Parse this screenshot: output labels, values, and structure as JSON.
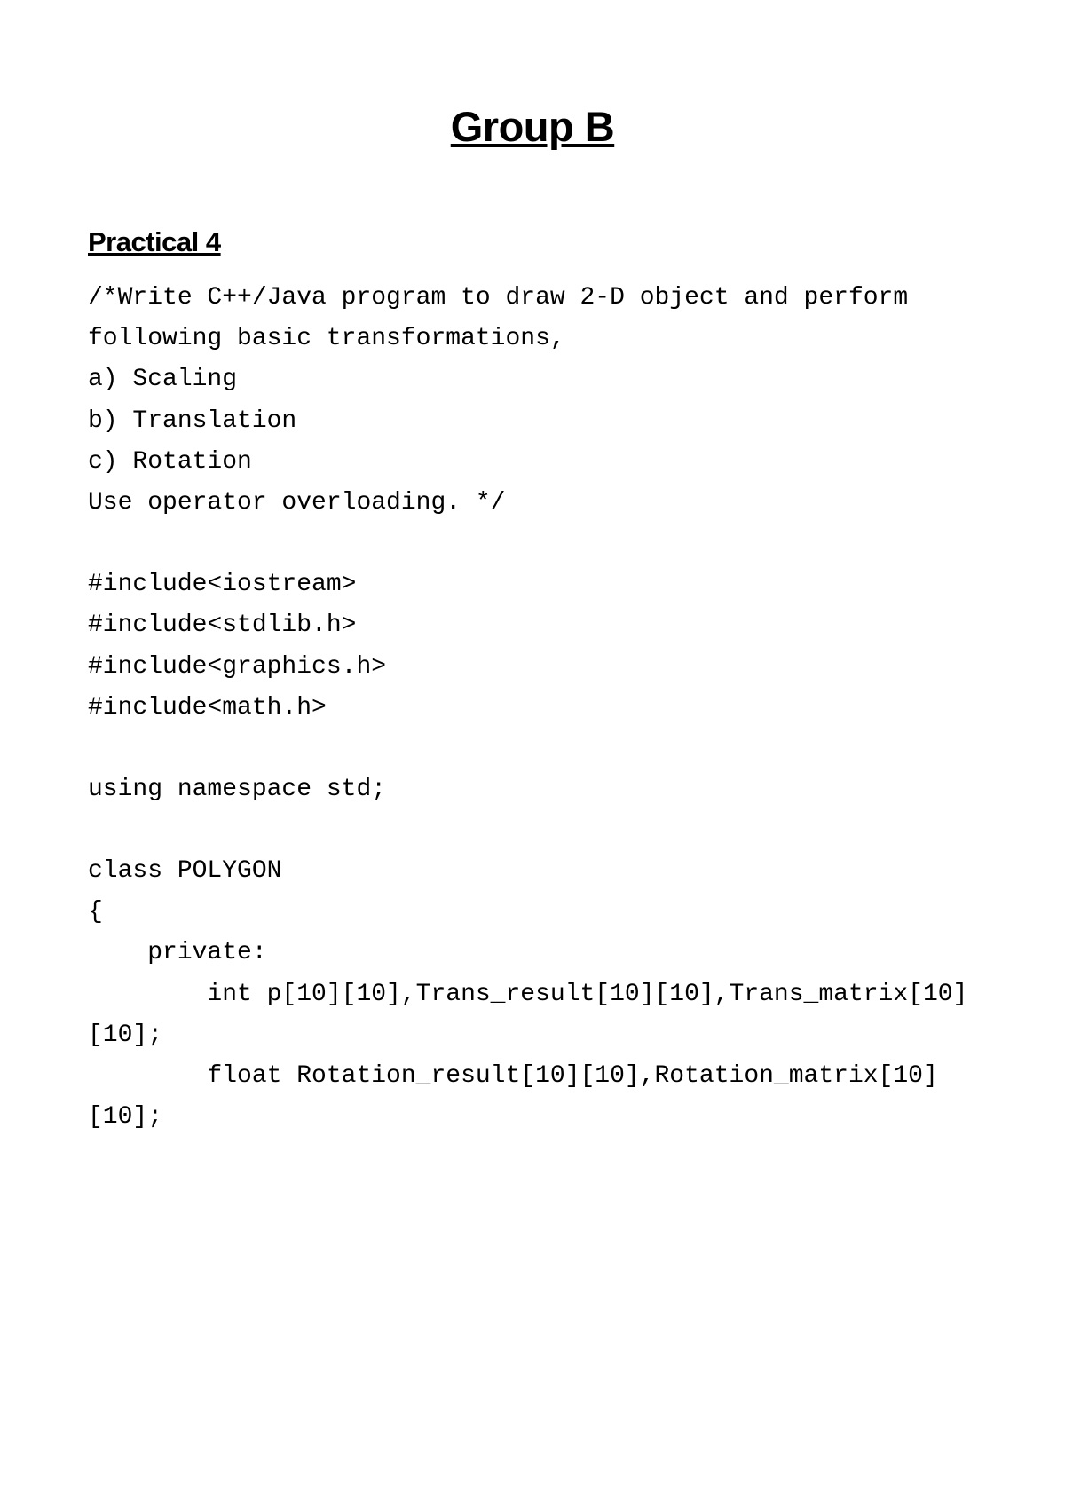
{
  "title": "Group B",
  "subtitle": "Practical 4",
  "lines": {
    "l1": "/*Write C++/Java program to draw 2-D object and perform following basic transformations,",
    "l2": "a) Scaling",
    "l3": "b) Translation",
    "l4": "c) Rotation",
    "l5": "Use operator overloading. */",
    "l6": "#include<iostream>",
    "l7": "#include<stdlib.h>",
    "l8": "#include<graphics.h>",
    "l9": "#include<math.h>",
    "l10": "using namespace std;",
    "l11": "class POLYGON",
    "l12": "{",
    "l13": "    private:",
    "l14": "        int p[10][10],Trans_result[10][10],Trans_matrix[10][10];",
    "l15": "        float Rotation_result[10][10],Rotation_matrix[10][10];"
  }
}
